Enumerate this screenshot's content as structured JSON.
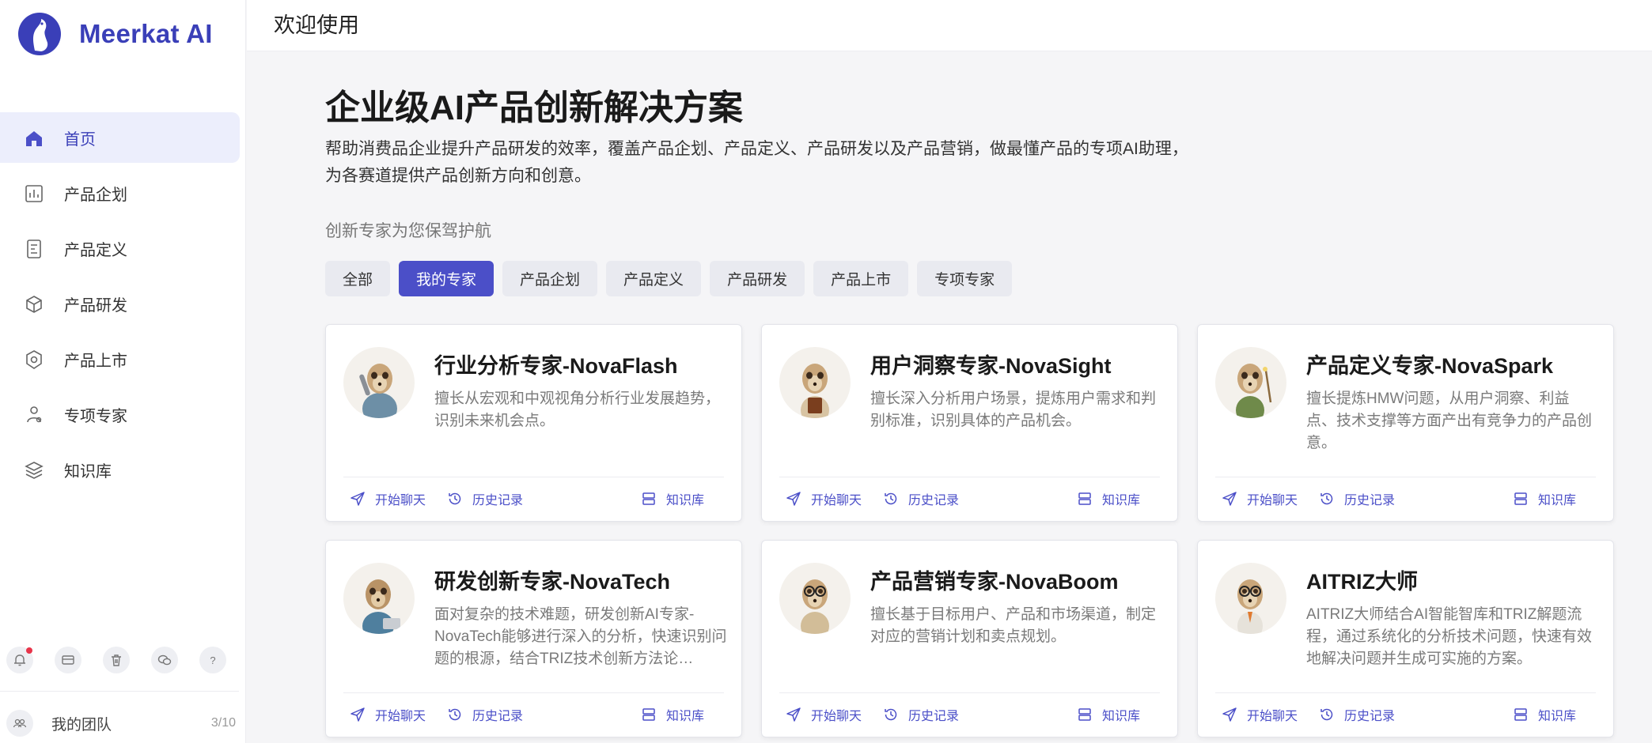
{
  "brand": {
    "name": "Meerkat AI",
    "accent": "#4b4fc8"
  },
  "header": {
    "title": "欢迎使用"
  },
  "sidebar": {
    "items": [
      {
        "label": "首页",
        "icon": "home-icon",
        "active": true
      },
      {
        "label": "产品企划",
        "icon": "chart-icon",
        "active": false
      },
      {
        "label": "产品定义",
        "icon": "document-icon",
        "active": false
      },
      {
        "label": "产品研发",
        "icon": "cube-icon",
        "active": false
      },
      {
        "label": "产品上市",
        "icon": "launch-icon",
        "active": false
      },
      {
        "label": "专项专家",
        "icon": "expert-icon",
        "active": false
      },
      {
        "label": "知识库",
        "icon": "layers-icon",
        "active": false
      }
    ],
    "bottom_icons": [
      "bell-icon",
      "card-icon",
      "trash-icon",
      "wechat-icon",
      "help-icon"
    ],
    "team": {
      "label": "我的团队",
      "count": "3/10"
    }
  },
  "main": {
    "title": "企业级AI产品创新解决方案",
    "desc_line1": "帮助消费品企业提升产品研发的效率，覆盖产品企划、产品定义、产品研发以及产品营销，做最懂产品的专项AI助理，",
    "desc_line2": "为各赛道提供产品创新方向和创意。",
    "subtitle": "创新专家为您保驾护航",
    "tabs": [
      {
        "label": "全部",
        "active": false
      },
      {
        "label": "我的专家",
        "active": true
      },
      {
        "label": "产品企划",
        "active": false
      },
      {
        "label": "产品定义",
        "active": false
      },
      {
        "label": "产品研发",
        "active": false
      },
      {
        "label": "产品上市",
        "active": false
      },
      {
        "label": "专项专家",
        "active": false
      }
    ],
    "action_labels": {
      "chat": "开始聊天",
      "history": "历史记录",
      "kb": "知识库"
    },
    "cards": [
      {
        "title": "行业分析专家-NovaFlash",
        "desc": "擅长从宏观和中观视角分析行业发展趋势，识别未来机会点。"
      },
      {
        "title": "用户洞察专家-NovaSight",
        "desc": "擅长深入分析用户场景，提炼用户需求和判别标准，识别具体的产品机会。"
      },
      {
        "title": "产品定义专家-NovaSpark",
        "desc": "擅长提炼HMW问题，从用户洞察、利益点、技术支撑等方面产出有竞争力的产品创意。"
      },
      {
        "title": "研发创新专家-NovaTech",
        "desc": "面对复杂的技术难题，研发创新AI专家-NovaTech能够进行深入的分析，快速识别问题的根源，结合TRIZ技术创新方法论…"
      },
      {
        "title": "产品营销专家-NovaBoom",
        "desc": "擅长基于目标用户、产品和市场渠道，制定对应的营销计划和卖点规划。"
      },
      {
        "title": "AITRIZ大师",
        "desc": "AITRIZ大师结合AI智能智库和TRIZ解题流程，通过系统化的分析技术问题，快速有效地解决问题并生成可实施的方案。"
      }
    ]
  }
}
